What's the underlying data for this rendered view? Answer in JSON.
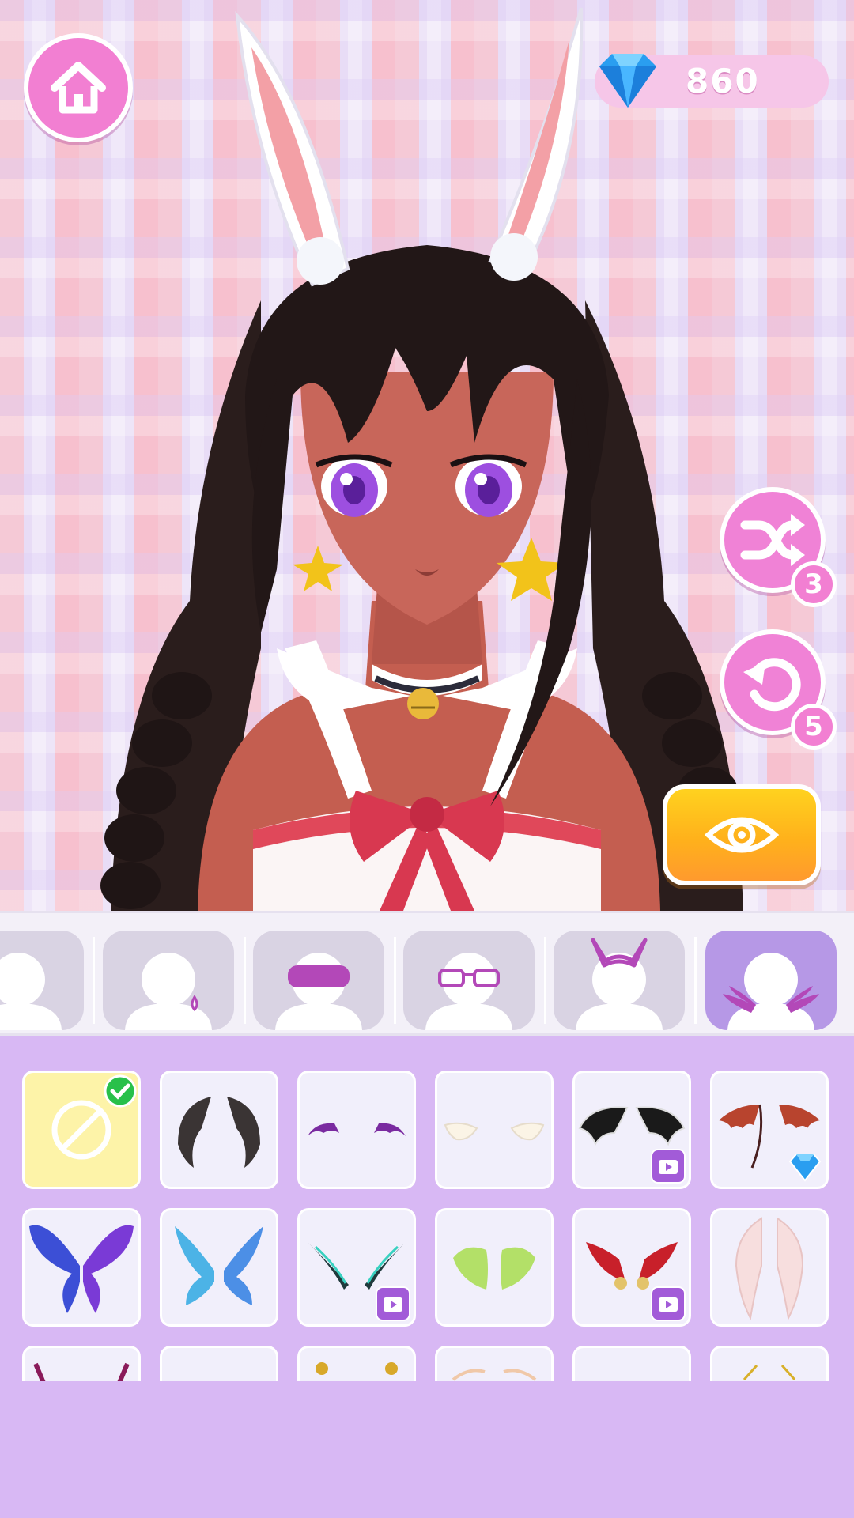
{
  "currency": {
    "icon": "diamond-icon",
    "amount": "860"
  },
  "buttons": {
    "home": {
      "icon": "home-icon"
    },
    "randomize": {
      "icon": "shuffle-icon",
      "remaining": "3"
    },
    "undo": {
      "icon": "undo-icon",
      "remaining": "5"
    },
    "preview": {
      "icon": "eye-icon"
    }
  },
  "categories": [
    {
      "id": "face",
      "icon": "head-silhouette-icon",
      "active": false
    },
    {
      "id": "earrings",
      "icon": "earring-icon",
      "active": false
    },
    {
      "id": "eye-mask",
      "icon": "eye-mask-icon",
      "active": false
    },
    {
      "id": "glasses",
      "icon": "glasses-icon",
      "active": false
    },
    {
      "id": "ears",
      "icon": "cat-ears-icon",
      "active": false
    },
    {
      "id": "wings",
      "icon": "wings-icon",
      "active": true
    }
  ],
  "items": [
    {
      "name": "none",
      "selected": true,
      "lock": "none"
    },
    {
      "name": "dark-feather-wings",
      "selected": false,
      "lock": "none"
    },
    {
      "name": "small-purple-bat-wings",
      "selected": false,
      "lock": "none"
    },
    {
      "name": "small-white-angel-wings",
      "selected": false,
      "lock": "none"
    },
    {
      "name": "black-white-feather-wings",
      "selected": false,
      "lock": "video"
    },
    {
      "name": "red-dragon-wings",
      "selected": false,
      "lock": "gem"
    },
    {
      "name": "blue-butterfly-wings",
      "selected": false,
      "lock": "none"
    },
    {
      "name": "crystal-fairy-wings",
      "selected": false,
      "lock": "none"
    },
    {
      "name": "teal-blade-wings",
      "selected": false,
      "lock": "video"
    },
    {
      "name": "green-fairy-wings",
      "selected": false,
      "lock": "none"
    },
    {
      "name": "red-gold-feather-wings",
      "selected": false,
      "lock": "video"
    },
    {
      "name": "pink-angel-wings",
      "selected": false,
      "lock": "none"
    }
  ],
  "colors": {
    "accent_pink": "#f27fd2",
    "panel_purple": "#d8b8f4",
    "active_tab": "#b698e6",
    "preview_yellow": "#ffc21f"
  }
}
